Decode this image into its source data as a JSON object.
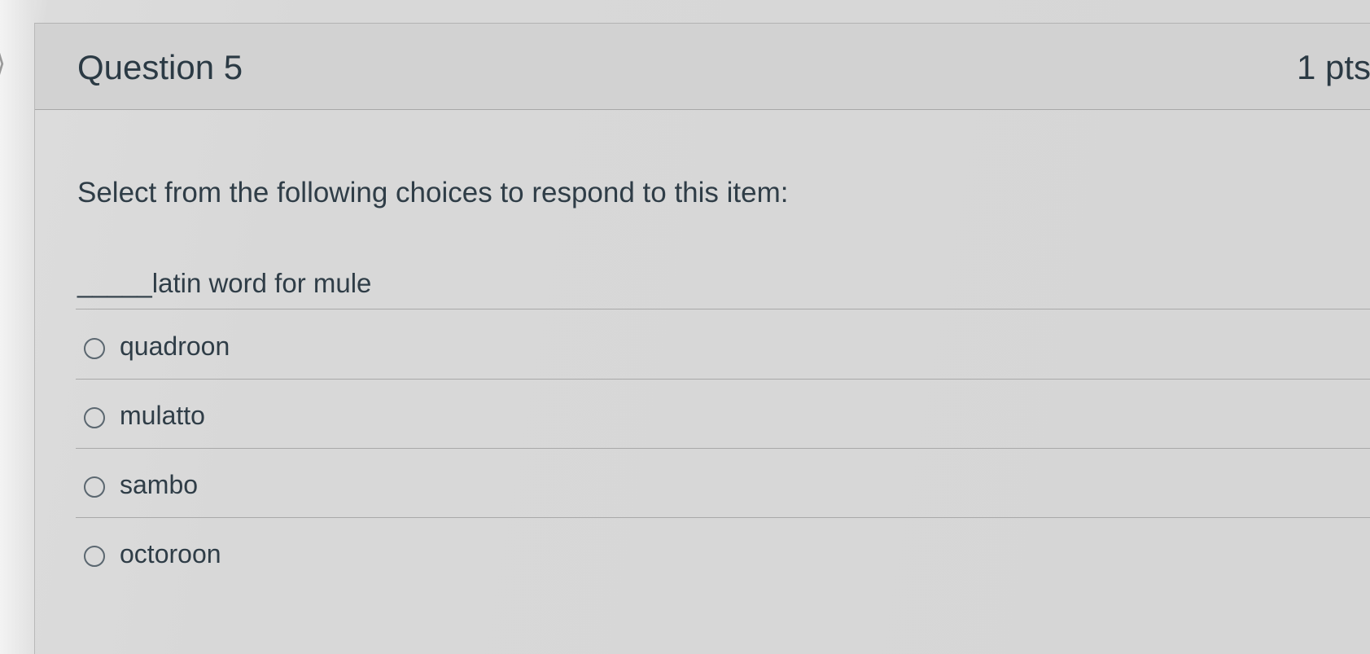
{
  "header": {
    "title": "Question 5",
    "points": "1 pts"
  },
  "question": {
    "instruction": "Select from the following choices to respond to this item:",
    "prompt": "_____latin word for mule"
  },
  "answers": [
    {
      "label": "quadroon",
      "selected": false
    },
    {
      "label": "mulatto",
      "selected": false
    },
    {
      "label": "sambo",
      "selected": false
    },
    {
      "label": "octoroon",
      "selected": false
    }
  ],
  "icons": {
    "gutter": "chevron-right-icon",
    "answer": "radio-button-icon"
  }
}
